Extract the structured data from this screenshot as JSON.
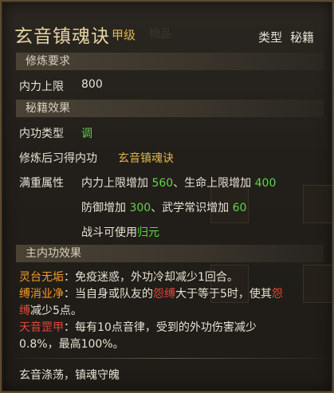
{
  "header": {
    "title": "玄音镇魂诀",
    "grade": "甲级",
    "type_label": "类型",
    "type_value": "秘籍",
    "bg_tab_label": "物品"
  },
  "sections": {
    "requirements": "修炼要求",
    "effects": "秘籍效果",
    "main_effects": "主内功效果"
  },
  "requirements": {
    "label": "内力上限",
    "value": "800"
  },
  "effects": {
    "type_label": "内功类型",
    "type_value": "调",
    "learn_label": "修炼后习得内功",
    "learn_value": "玄音镇魂诀",
    "full_label": "满重属性",
    "full_line1_a": "内力上限增加 ",
    "full_line1_b": "560",
    "full_line1_c": "、生命上限增加 ",
    "full_line1_d": "400",
    "full_line2_a": "防御增加 ",
    "full_line2_b": "300",
    "full_line2_c": "、武学常识增加 ",
    "full_line2_d": "60",
    "full_line3_a": "战斗可使用",
    "full_line3_b": "归元"
  },
  "main_effects": {
    "e1_name": "灵台无垢",
    "e1_text": "：免疫迷惑，外功冷却减少1回合。",
    "e2_name": "缚消业净",
    "e2_text_a": "：当自身或队友的",
    "e2_key": "怨缚",
    "e2_text_b": "大于等于5时，使其",
    "e2_key2a": "怨",
    "e2_key2b": "缚",
    "e2_text_c": "减少5点。",
    "e3_name": "天音罡甲",
    "e3_text_a": "：每有10点音律，受到的外功伤害减少",
    "e3_text_b": "0.8%，最高100%。"
  },
  "flavor": "玄音涤荡，镇魂守魄",
  "colors": {
    "title": "#e6d3a3",
    "grade": "#e0b64a",
    "green": "#5fd34a",
    "gold": "#e0b64a",
    "red": "#e0473a",
    "orange": "#f09a2a"
  }
}
